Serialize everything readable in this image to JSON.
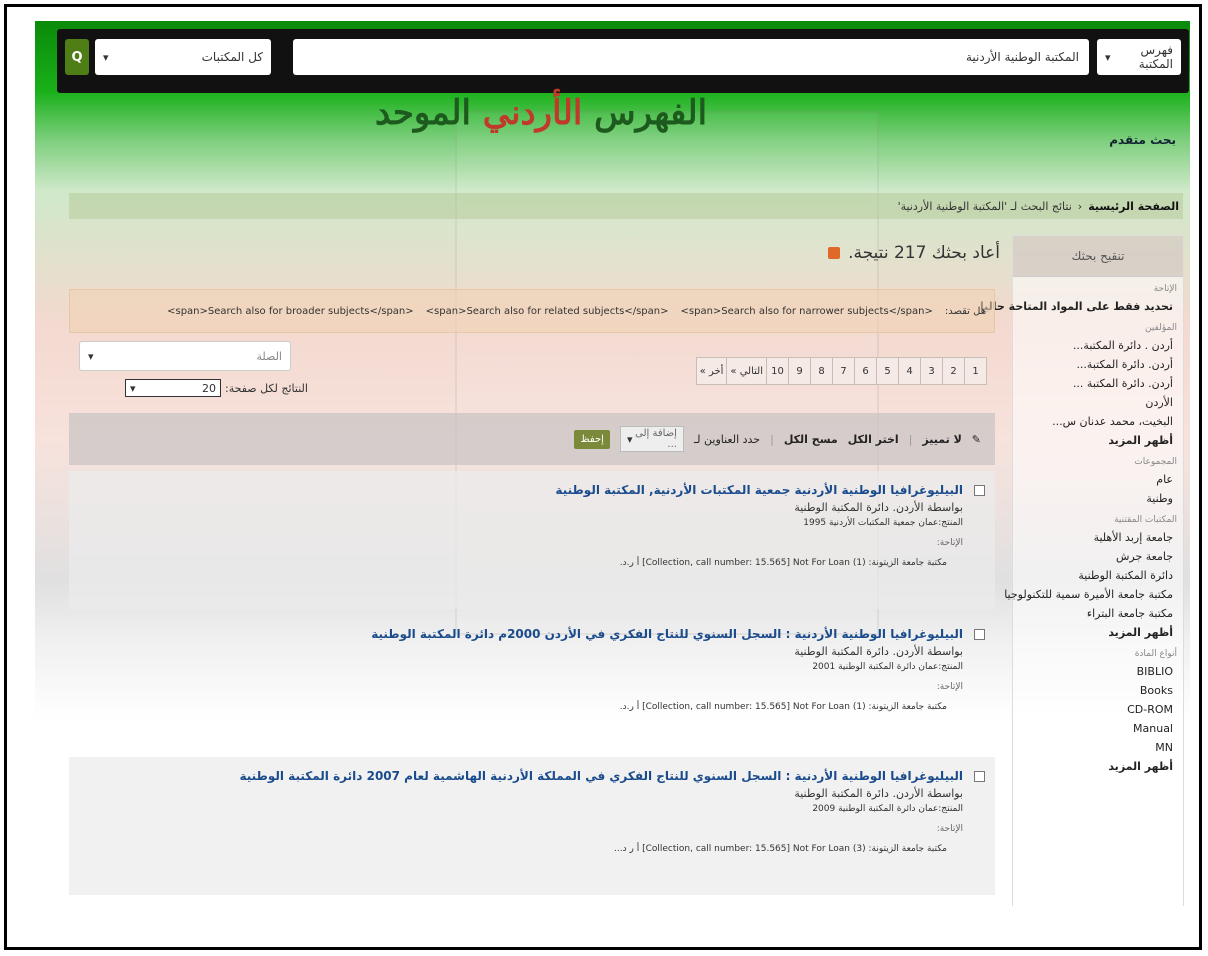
{
  "header": {
    "catalog_select": "فهرس المكتبة",
    "query_value": "المكتبة الوطنية الأردنية",
    "library_select": "كل المكتبات",
    "go_label": "Q"
  },
  "logo": {
    "part1": "الفهرس",
    "part2": "الأردني",
    "part3": "الموحد"
  },
  "advanced_search": "بحث متقدم",
  "breadcrumb": {
    "home": "الصفحة الرئيسية",
    "sep": "‹",
    "current": "نتائج البحث لـ 'المكتبة الوطنية الأردنية'"
  },
  "sidebar": {
    "header": "تنقيح بحثك",
    "availability_label": "الإتاحة",
    "availability_item": "تحديد فقط على المواد المتاحة حاليا",
    "authors_label": "المؤلفين",
    "authors": [
      "أردن . دائرة المكتبة...",
      "أردن. دائرة المكتبة...",
      "أردن. دائرة المكتبة ...",
      "الأردن",
      "البخيت، محمد عدنان س..."
    ],
    "authors_more": "أظهر المزيد",
    "collections_label": "المجموعات",
    "collections": [
      "عام",
      "وطنية"
    ],
    "libraries_label": "المكتبات المقتنية",
    "libraries": [
      "جامعة إربد الأهلية",
      "جامعة جرش",
      "دائرة المكتبة الوطنية",
      "مكتبة جامعة الأميرة سمية للتكنولوجيا",
      "مكتبة جامعة البتراء"
    ],
    "libraries_more": "أظهر المزيد",
    "types_label": "أنواع المادة",
    "types": [
      "BIBLIO",
      "Books",
      "CD-ROM",
      "Manual",
      "MN"
    ],
    "types_more": "أظهر المزيد"
  },
  "results_title": "أعاد بحثك 217 نتيجة.",
  "did_you_mean": {
    "label": "هل تقصد:",
    "links": [
      "<span>Search also for narrower subjects</span>",
      "<span>Search also for related subjects</span>",
      "<span>Search also for broader subjects</span>"
    ]
  },
  "pagination": [
    "1",
    "2",
    "3",
    "4",
    "5",
    "6",
    "7",
    "8",
    "9",
    "10",
    "التالي »",
    "أخر »"
  ],
  "sort_select": "الصلة",
  "per_page_label": "النتائج لكل صفحة:",
  "per_page_value": "20",
  "toolbar": {
    "unhighlight": "لا تمييز",
    "select_all": "اختر الكل",
    "clear_all": "مسح الكل",
    "select_titles": "حدد العناوين لـ",
    "add_to": "إضافة إلى ...",
    "save": "إحفظ"
  },
  "results": [
    {
      "title": "البيليوغرافيا الوطنية الأردنية جمعية المكتبات الأردنية, المكتبة الوطنية",
      "by": "بواسطة الأردن. دائرة المكتبة الوطنية",
      "publisher": "المنتج:عمان جمعية المكتبات الأردنية 1995",
      "availability": "الإتاحة:",
      "location": "مكتبة جامعة الزيتونة: (1) Collection, call number: 15.565] Not For Loan] أ ر.د."
    },
    {
      "title": "البيليوغرافيا الوطنية الأردنية : السجل السنوي للنتاج الفكري في الأردن 2000م دائرة المكتبة الوطنية",
      "by": "بواسطة الأردن. دائرة المكتبة الوطنية",
      "publisher": "المنتج:عمان دائرة المكتبة الوطنية 2001",
      "availability": "الإتاحة:",
      "location": "مكتبة جامعة الزيتونة: (1) Collection, call number: 15.565] Not For Loan] أ ر.د."
    },
    {
      "title": "البيليوغرافيا الوطنية الأردنية : السجل السنوي للنتاج الفكري في المملكة الأردنية الهاشمية لعام 2007 دائرة المكتبة الوطنية",
      "by": "بواسطة الأردن. دائرة المكتبة الوطنية",
      "publisher": "المنتج:عمان دائرة المكتبة الوطنية 2009",
      "availability": "الإتاحة:",
      "location": "مكتبة جامعة الزيتونة: (3) Collection, call number: 15.565] Not For Loan] أ ر د..."
    }
  ]
}
